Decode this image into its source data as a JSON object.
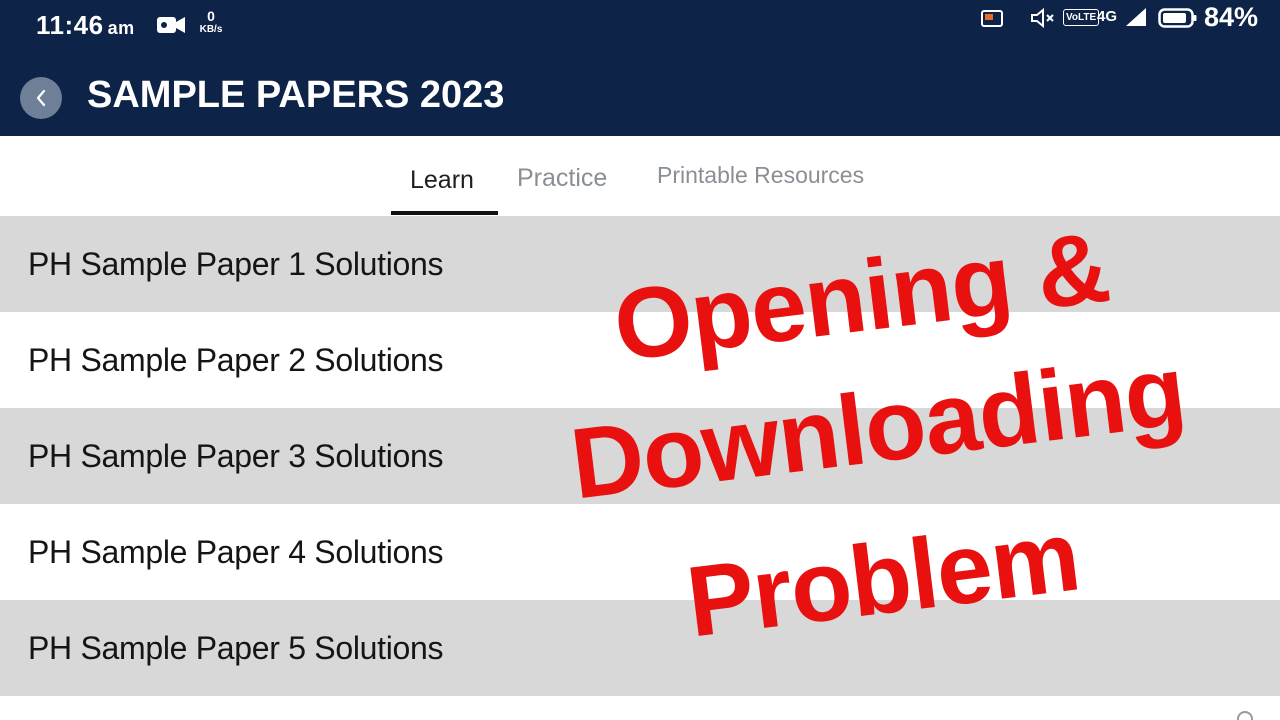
{
  "status_bar": {
    "time": "11:46",
    "ampm": "am",
    "net_speed_value": "0",
    "net_speed_unit": "KB/s",
    "volte": "VoLTE",
    "network": "4G",
    "battery": "84%",
    "icons": [
      "video-camera-icon",
      "cast-icon",
      "mute-icon",
      "signal-icon",
      "battery-icon"
    ]
  },
  "header": {
    "title": "SAMPLE PAPERS 2023",
    "back_icon": "chevron-left-icon",
    "background": "#0d2347"
  },
  "tabs": [
    {
      "label": "Learn",
      "active": true
    },
    {
      "label": "Practice",
      "active": false
    },
    {
      "label": "Printable Resources",
      "active": false
    }
  ],
  "list": {
    "items": [
      {
        "label": "PH Sample Paper 1 Solutions"
      },
      {
        "label": "PH Sample Paper 2 Solutions"
      },
      {
        "label": "PH Sample Paper 3 Solutions"
      },
      {
        "label": "PH Sample Paper 4 Solutions"
      },
      {
        "label": "PH Sample Paper 5 Solutions"
      }
    ]
  },
  "overlay": {
    "line1": "Opening &",
    "line2": "Downloading",
    "line3": "Problem",
    "color": "#e8110f"
  }
}
